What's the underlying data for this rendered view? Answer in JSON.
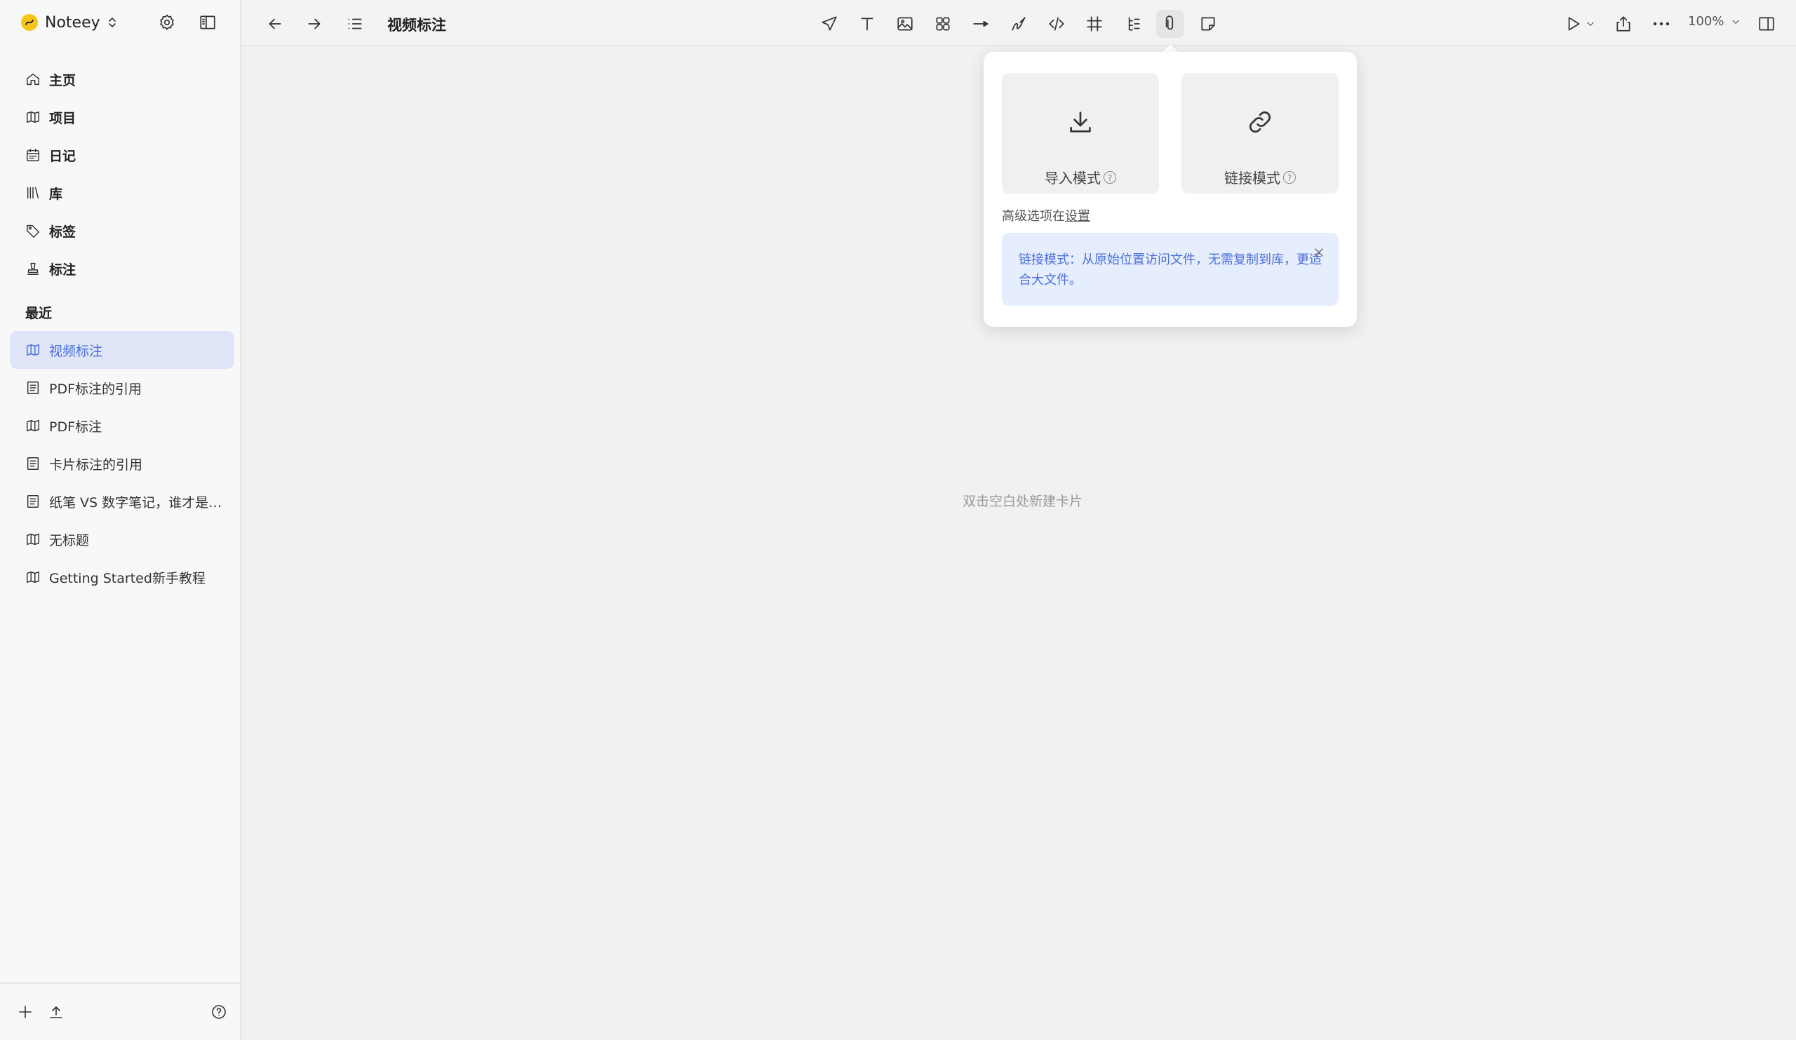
{
  "brand": {
    "name": "Noteey",
    "icon": "noteey-logo"
  },
  "sidebar": {
    "nav": [
      {
        "label": "主页",
        "icon": "home-icon"
      },
      {
        "label": "项目",
        "icon": "map-icon"
      },
      {
        "label": "日记",
        "icon": "calendar-icon"
      },
      {
        "label": "库",
        "icon": "library-icon"
      },
      {
        "label": "标签",
        "icon": "tag-icon"
      },
      {
        "label": "标注",
        "icon": "stamp-icon"
      }
    ],
    "recent_title": "最近",
    "recent": [
      {
        "label": "视频标注",
        "icon": "map-icon",
        "active": true
      },
      {
        "label": "PDF标注的引用",
        "icon": "document-icon"
      },
      {
        "label": "PDF标注",
        "icon": "map-icon"
      },
      {
        "label": "卡片标注的引用",
        "icon": "document-icon"
      },
      {
        "label": "纸笔 VS 数字笔记，谁才是最...",
        "icon": "document-icon"
      },
      {
        "label": "无标题",
        "icon": "map-icon"
      },
      {
        "label": "Getting Started新手教程",
        "icon": "map-icon"
      }
    ]
  },
  "topbar": {
    "title": "视频标注",
    "zoom": "100%"
  },
  "canvas": {
    "hint": "双击空白处新建卡片"
  },
  "popover": {
    "import_label": "导入模式",
    "link_label": "链接模式",
    "advanced_prefix": "高级选项在",
    "advanced_link": "设置",
    "info_text": "链接模式：从原始位置访问文件，无需复制到库，更适合大文件。"
  },
  "colors": {
    "accent": "#4a6fd8",
    "active_bg": "#dfe5f7",
    "info_bg": "#e6edfc"
  }
}
